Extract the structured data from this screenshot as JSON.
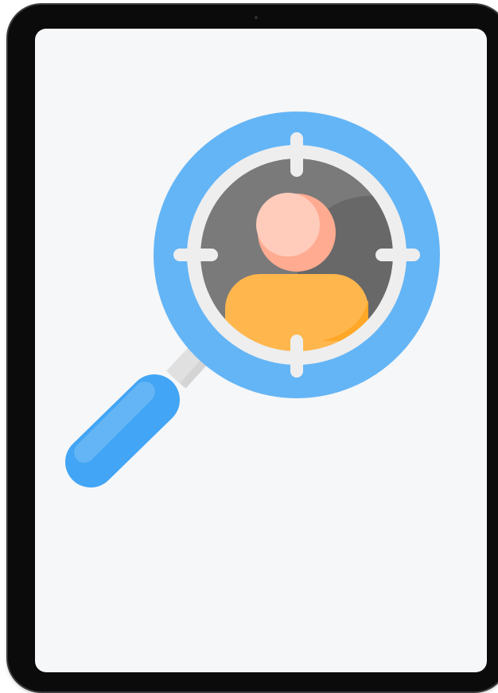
{
  "device": {
    "kind": "tablet",
    "frame_color": "#0b0b0c",
    "screen_color": "#f6f7f8"
  },
  "illustration": {
    "subject": "magnifying-glass-person-search",
    "icons": [
      "magnifying-glass-icon",
      "crosshair-icon",
      "person-icon"
    ],
    "colors": {
      "lens_ring": "#64b5f6",
      "handle": "#42a5f5",
      "handle_highlight": "#64b5f6",
      "neck": "#e0e0e0",
      "crosshair": "#eeeeee",
      "lens_inner": "#7a7a7a",
      "lens_shadow": "#5a5a5a",
      "head": "#ffab91",
      "head_highlight": "#ffccbc",
      "body": "#ffb74d",
      "body_shadow": "#ffa726"
    }
  }
}
